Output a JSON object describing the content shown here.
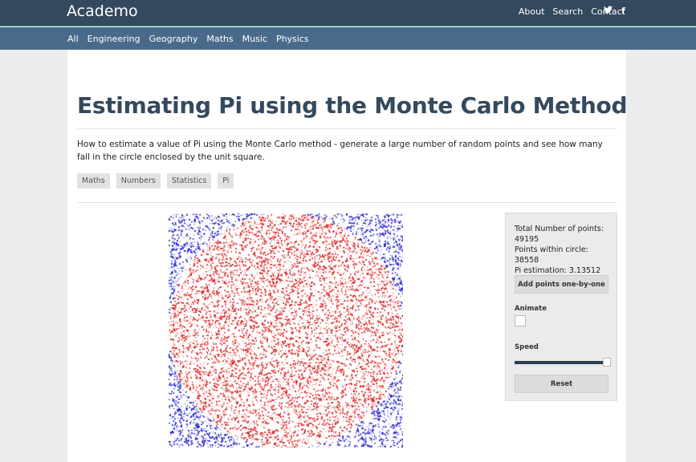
{
  "header": {
    "logo": "Academo",
    "nav": [
      "About",
      "Search",
      "Contact"
    ],
    "social": [
      "twitter-icon",
      "facebook-icon"
    ],
    "social_glyphs": {
      "twitter": "🐦",
      "facebook": "f"
    }
  },
  "categories": [
    "All",
    "Engineering",
    "Geography",
    "Maths",
    "Music",
    "Physics"
  ],
  "article": {
    "title": "Estimating Pi using the Monte Carlo Method",
    "description": "How to estimate a value of Pi using the Monte Carlo method - generate a large number of random points and see how many fall in the circle enclosed by the unit square.",
    "tags": [
      "Maths",
      "Numbers",
      "Statistics",
      "Pi"
    ]
  },
  "simulation": {
    "total_points": 49195,
    "points_inside": 38558,
    "pi_estimate": "3.13512",
    "inside_color": "#dd2222",
    "outside_color": "#2222cc"
  },
  "panel": {
    "total_label": "Total Number of points:",
    "total_value": "49195",
    "inside_text": "Points within circle: 38558",
    "pi_text": "Pi estimation: 3.13512",
    "add_button": "Add points one-by-one",
    "animate_label": "Animate",
    "animate_checked": false,
    "speed_label": "Speed",
    "speed_level": 1.0,
    "reset_button": "Reset"
  },
  "colors": {
    "topbar": "#34495e",
    "catbar": "#4a6a8b",
    "title": "#34495e"
  }
}
